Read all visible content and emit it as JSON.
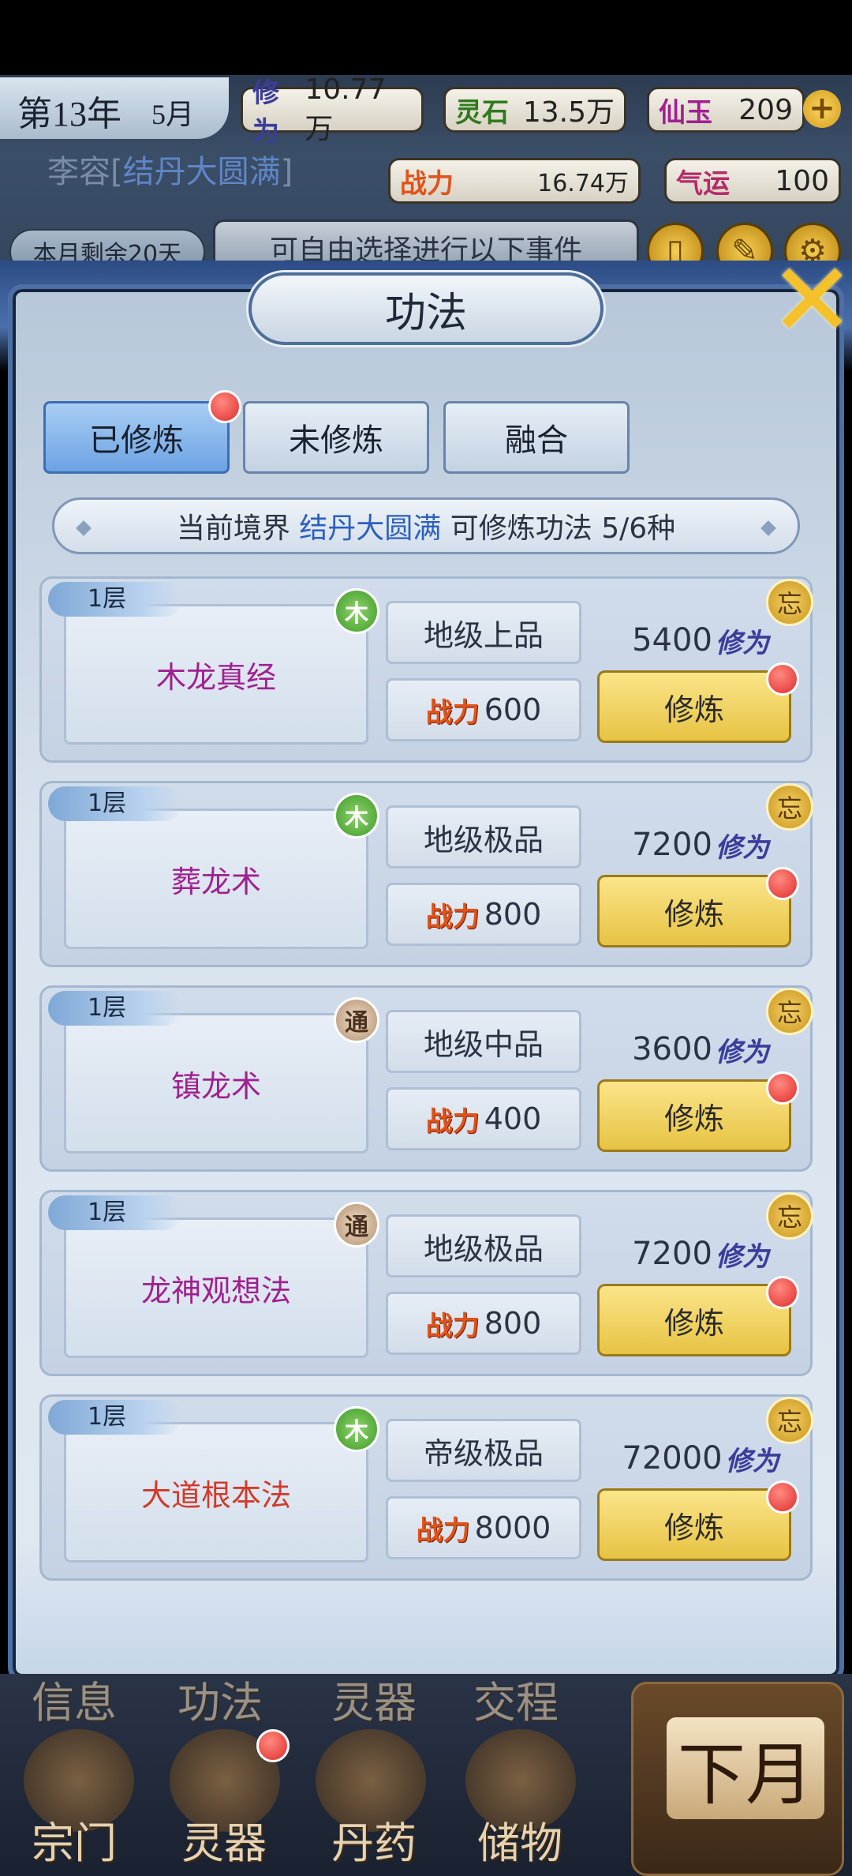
{
  "header": {
    "year": "第13年",
    "month": "5月",
    "resources": [
      {
        "key": "修为",
        "value": "10.77万"
      },
      {
        "key": "灵石",
        "value": "13.5万"
      },
      {
        "key": "仙玉",
        "value": "209"
      }
    ],
    "character_name": "李容",
    "character_realm": "结丹大圆满",
    "power_label": "战力",
    "power_value": "16.74万",
    "luck_label": "气运",
    "luck_value": "100",
    "days_left": "本月剩余20天",
    "event_hint": "可自由选择进行以下事件",
    "add_glyph": "+"
  },
  "panel": {
    "title": "功法",
    "close_glyph": "✕",
    "tabs": [
      "已修炼",
      "未修炼",
      "融合"
    ],
    "realm_prefix": "当前境界",
    "realm_value": "结丹大圆满",
    "realm_suffix": "可修炼功法 5/6种"
  },
  "skills": [
    {
      "layer": "1层",
      "name": "木龙真经",
      "name_color": "#a0208f",
      "element": "木",
      "element_type": "wood",
      "grade": "地级上品",
      "power_label": "战力",
      "power": "600",
      "cost": "5400",
      "cost_label": "修为",
      "forget": "忘",
      "train": "修炼"
    },
    {
      "layer": "1层",
      "name": "葬龙术",
      "name_color": "#a0208f",
      "element": "木",
      "element_type": "wood",
      "grade": "地级极品",
      "power_label": "战力",
      "power": "800",
      "cost": "7200",
      "cost_label": "修为",
      "forget": "忘",
      "train": "修炼"
    },
    {
      "layer": "1层",
      "name": "镇龙术",
      "name_color": "#a0208f",
      "element": "通",
      "element_type": "tong",
      "grade": "地级中品",
      "power_label": "战力",
      "power": "400",
      "cost": "3600",
      "cost_label": "修为",
      "forget": "忘",
      "train": "修炼"
    },
    {
      "layer": "1层",
      "name": "龙神观想法",
      "name_color": "#a0208f",
      "element": "通",
      "element_type": "tong",
      "grade": "地级极品",
      "power_label": "战力",
      "power": "800",
      "cost": "7200",
      "cost_label": "修为",
      "forget": "忘",
      "train": "修炼"
    },
    {
      "layer": "1层",
      "name": "大道根本法",
      "name_color": "#d23a2a",
      "element": "木",
      "element_type": "wood",
      "grade": "帝级极品",
      "power_label": "战力",
      "power": "8000",
      "cost": "72000",
      "cost_label": "修为",
      "forget": "忘",
      "train": "修炼"
    }
  ],
  "bottom_nav": {
    "top_row": [
      "信息",
      "功法",
      "灵器",
      "交程"
    ],
    "items": [
      "宗门",
      "灵器",
      "丹药",
      "储物"
    ],
    "next_month": "下月"
  }
}
